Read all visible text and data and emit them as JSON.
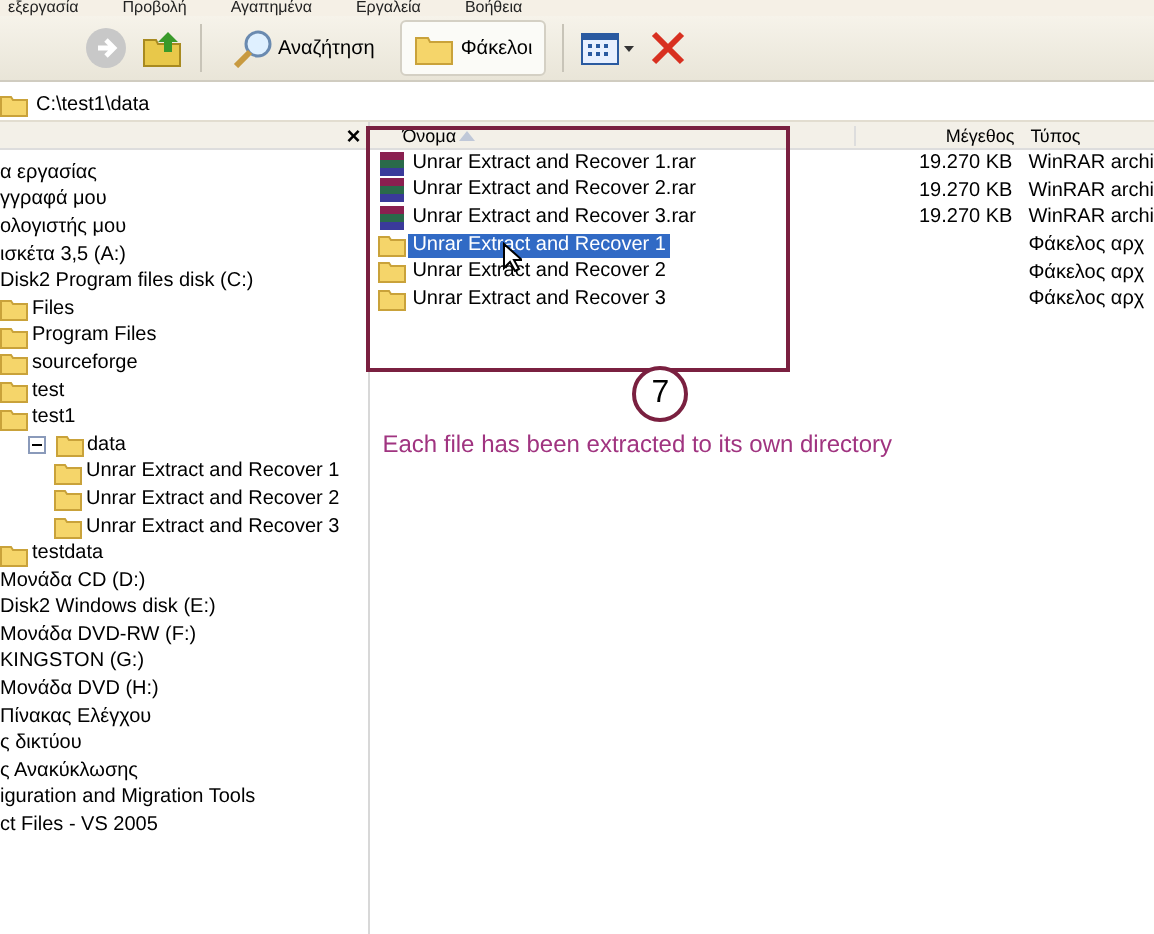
{
  "menu_bar": [
    "εξεργασία",
    "Προβολή",
    "Αγαπημένα",
    "Εργαλεία",
    "Βοήθεια"
  ],
  "toolbar": {
    "buttons": [
      {
        "label": "Αναζήτηση",
        "kind": "search",
        "selected": false
      },
      {
        "label": "Φάκελοι",
        "kind": "folders",
        "selected": true
      }
    ]
  },
  "address": "C:\\test1\\data",
  "folders_pane": {
    "close": "×",
    "tree": [
      {
        "label": "α εργασίας"
      },
      {
        "label": "γγραφά μου"
      },
      {
        "label": "ολογιστής μου"
      },
      {
        "label": "ισκέτα 3,5 (A:)"
      },
      {
        "label": "Disk2 Program files disk (C:)",
        "children": [
          {
            "label": "Files",
            "kind": "folder"
          },
          {
            "label": "Program Files",
            "kind": "folder"
          },
          {
            "label": "sourceforge",
            "kind": "folder"
          },
          {
            "label": "test",
            "kind": "folder"
          },
          {
            "label": "test1",
            "kind": "folder",
            "children": [
              {
                "label": "data",
                "kind": "folder",
                "expanded": true,
                "children": [
                  {
                    "label": "Unrar Extract and Recover 1",
                    "kind": "folder"
                  },
                  {
                    "label": "Unrar Extract and Recover 2",
                    "kind": "folder"
                  },
                  {
                    "label": "Unrar Extract and Recover 3",
                    "kind": "folder"
                  }
                ]
              }
            ]
          },
          {
            "label": "testdata",
            "kind": "folder"
          }
        ]
      },
      {
        "label": "Μονάδα CD (D:)"
      },
      {
        "label": "Disk2 Windows disk (E:)"
      },
      {
        "label": "Μονάδα DVD-RW (F:)"
      },
      {
        "label": "KINGSTON (G:)"
      },
      {
        "label": "Μονάδα DVD (H:)"
      },
      {
        "label": "Πίνακας Ελέγχου"
      },
      {
        "label": "ς δικτύου"
      },
      {
        "label": "ς Ανακύκλωσης"
      },
      {
        "label": "iguration and Migration Tools"
      },
      {
        "label": "ct Files - VS 2005"
      }
    ]
  },
  "file_list": {
    "columns": [
      "Όνομα",
      "Μέγεθος",
      "Τύπος"
    ],
    "rows": [
      {
        "name": "Unrar Extract and Recover 1.rar",
        "size": "19.270 KB",
        "type": "WinRAR archi",
        "kind": "archive",
        "selected": false
      },
      {
        "name": "Unrar Extract and Recover 2.rar",
        "size": "19.270 KB",
        "type": "WinRAR archi",
        "kind": "archive",
        "selected": false
      },
      {
        "name": "Unrar Extract and Recover 3.rar",
        "size": "19.270 KB",
        "type": "WinRAR archi",
        "kind": "archive",
        "selected": false
      },
      {
        "name": "Unrar Extract and Recover 1",
        "type": "Φάκελος αρχ",
        "kind": "folder",
        "selected": true
      },
      {
        "name": "Unrar Extract and Recover 2",
        "type": "Φάκελος αρχ",
        "kind": "folder",
        "selected": false
      },
      {
        "name": "Unrar Extract and Recover 3",
        "type": "Φάκελος αρχ",
        "kind": "folder",
        "selected": false
      }
    ]
  },
  "annotation": {
    "step": "7",
    "caption": "Each file has been extracted to its own directory"
  }
}
